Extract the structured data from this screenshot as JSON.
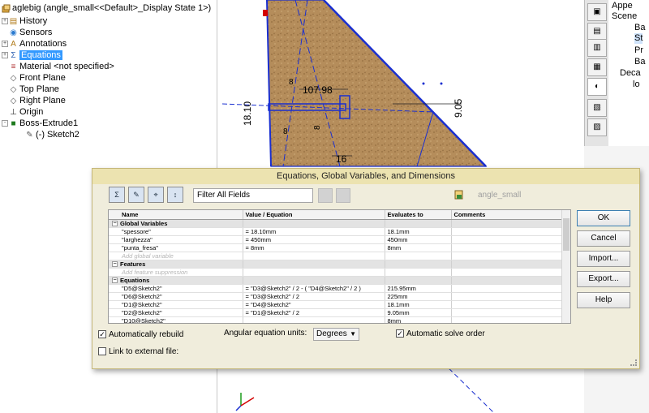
{
  "tree": {
    "root": "aglebig  (angle_small<<Default>_Display State 1>)",
    "items": [
      {
        "label": "History",
        "icon": "folder-icon",
        "expander": "+"
      },
      {
        "label": "Sensors",
        "icon": "sensor-icon",
        "expander": ""
      },
      {
        "label": "Annotations",
        "icon": "annotation-icon",
        "expander": "+"
      },
      {
        "label": "Equations",
        "icon": "equations-icon",
        "expander": "+"
      },
      {
        "label": "Material <not specified>",
        "icon": "material-icon",
        "expander": ""
      },
      {
        "label": "Front Plane",
        "icon": "plane-icon",
        "expander": ""
      },
      {
        "label": "Top Plane",
        "icon": "plane-icon",
        "expander": ""
      },
      {
        "label": "Right Plane",
        "icon": "plane-icon",
        "expander": ""
      },
      {
        "label": "Origin",
        "icon": "origin-icon",
        "expander": ""
      },
      {
        "label": "Boss-Extrude1",
        "icon": "extrude-icon",
        "expander": "-"
      },
      {
        "label": "(-) Sketch2",
        "icon": "sketch-icon",
        "expander": ""
      }
    ]
  },
  "viewport": {
    "dimensions": [
      "107.98",
      "18.10",
      "9.05",
      "16",
      "8",
      "8",
      "8"
    ]
  },
  "task_pane": {
    "items": [
      "Appe",
      "Scene",
      "Ba",
      "St",
      "Pr",
      "Ba",
      "Deca",
      "lo"
    ]
  },
  "dialog": {
    "title": "Equations, Global Variables, and Dimensions",
    "filter_placeholder": "Filter All Fields",
    "configuration": "angle_small",
    "columns": [
      "Name",
      "Value / Equation",
      "Evaluates to",
      "Comments"
    ],
    "rows": [
      {
        "type": "section",
        "name": "Global Variables",
        "value": "",
        "eval": "",
        "comment": ""
      },
      {
        "type": "data",
        "name": "\"spessore\"",
        "value": "= 18.10mm",
        "eval": "18.1mm",
        "comment": ""
      },
      {
        "type": "data",
        "name": "\"larghezza\"",
        "value": "= 450mm",
        "eval": "450mm",
        "comment": ""
      },
      {
        "type": "data",
        "name": "\"punta_fresa\"",
        "value": "= 8mm",
        "eval": "8mm",
        "comment": ""
      },
      {
        "type": "add",
        "name": "Add global variable",
        "value": "",
        "eval": "",
        "comment": ""
      },
      {
        "type": "section",
        "name": "Features",
        "value": "",
        "eval": "",
        "comment": ""
      },
      {
        "type": "add",
        "name": "Add feature suppression",
        "value": "",
        "eval": "",
        "comment": ""
      },
      {
        "type": "section",
        "name": "Equations",
        "value": "",
        "eval": "",
        "comment": ""
      },
      {
        "type": "data",
        "name": "\"D5@Sketch2\"",
        "value": "= \"D3@Sketch2\" / 2 - ( \"D4@Sketch2\" / 2 )",
        "eval": "215.95mm",
        "comment": ""
      },
      {
        "type": "data",
        "name": "\"D6@Sketch2\"",
        "value": "= \"D3@Sketch2\" / 2",
        "eval": "225mm",
        "comment": ""
      },
      {
        "type": "data",
        "name": "\"D1@Sketch2\"",
        "value": "= \"D4@Sketch2\"",
        "eval": "18.1mm",
        "comment": ""
      },
      {
        "type": "data",
        "name": "\"D2@Sketch2\"",
        "value": "= \"D1@Sketch2\" / 2",
        "eval": "9.05mm",
        "comment": ""
      },
      {
        "type": "data",
        "name": "\"D10@Sketch2\"",
        "value": "",
        "eval": "8mm",
        "comment": ""
      }
    ],
    "buttons": {
      "ok": "OK",
      "cancel": "Cancel",
      "import": "Import...",
      "export": "Export...",
      "help": "Help"
    },
    "auto_rebuild": {
      "label": "Automatically rebuild",
      "checked": true
    },
    "angle_units_label": "Angular equation units:",
    "angle_units_value": "Degrees",
    "auto_solve": {
      "label": "Automatic solve order",
      "checked": true
    },
    "link_external": {
      "label": "Link to external file:",
      "checked": false
    }
  },
  "colors": {
    "dialog_bg": "#f0eddc",
    "title_bg": "#ece3b0",
    "selection": "#3399ff",
    "dimension": "#d40000",
    "sketch": "#1a2fd0",
    "wood": "#b89261"
  }
}
